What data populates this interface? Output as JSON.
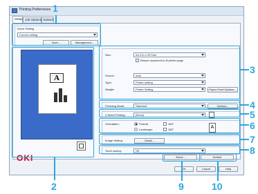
{
  "window": {
    "title": "Printing Preferences"
  },
  "tabs": [
    "Setup",
    "Job Options",
    "Extend"
  ],
  "driver_setting": {
    "group_label": "Driver Setting",
    "value": "Current setting",
    "save_label": "Save...",
    "management_label": "Management..."
  },
  "fields": {
    "size_label": "Size:",
    "size_value": "A4 210 x 297mm",
    "resize_label": "Resize document to fit printer page",
    "source_label": "Source:",
    "source_value": "Auto",
    "type_label": "Type:",
    "type_value": "Printer setting",
    "weight_label": "Weight:",
    "weight_value": "Printer Setting",
    "paper_feed_label": "Paper Feed Options...",
    "finishing_label": "Finishing Mode:",
    "finishing_value": "Standard",
    "options_label": "Options...",
    "twosided_label": "2-Sided Printing:",
    "twosided_value": "(None)",
    "orientation_label": "Orientation:",
    "portrait_label": "Portrait",
    "landscape_label": "Landscape",
    "rotate_label": "180°",
    "image_setting_label": "Image Setting:",
    "detail_label": "Detail...",
    "toner_label": "Toner saving:",
    "toner_value": "Off"
  },
  "buttons": {
    "about": "About...",
    "default": "Default",
    "ok": "OK",
    "cancel": "Cancel",
    "help": "Help"
  },
  "brand": {
    "logo": "OKI",
    "color": "#c8102e"
  },
  "callouts": [
    "1",
    "2",
    "3",
    "4",
    "5",
    "6",
    "7",
    "8",
    "9",
    "10"
  ],
  "colors": {
    "accent": "#2aa6df"
  }
}
